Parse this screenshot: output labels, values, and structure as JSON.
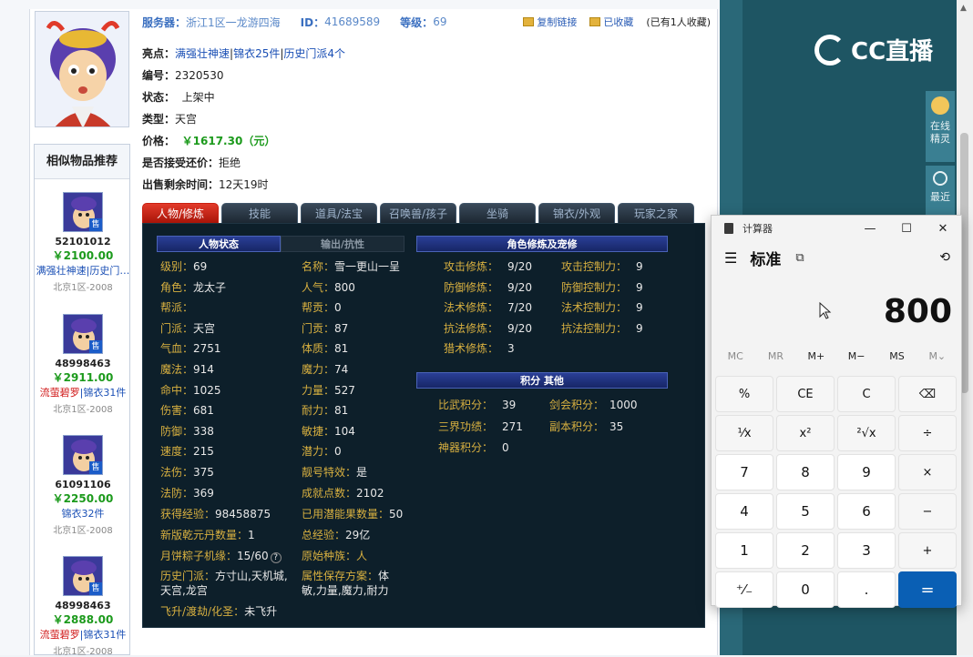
{
  "header": {
    "server_label": "服务器：",
    "server_value": "浙江1区一龙游四海",
    "id_label": "ID：",
    "id_value": "41689589",
    "level_label": "等级：",
    "level_value": "69",
    "copy_link": "复制链接",
    "favorited": "已收藏",
    "fav_count": "(已有1人收藏)"
  },
  "details": {
    "highlights_key": "亮点：",
    "highlights": [
      "满强壮神速",
      "锦衣25件",
      "历史门派4个"
    ],
    "number_key": "编号：",
    "number_value": "2320530",
    "status_key": "状态：",
    "status_value": "上架中",
    "type_key": "类型：",
    "type_value": "天宫",
    "price_key": "价格：",
    "price_value": "￥1617.30（元）",
    "counter_key": "是否接受还价：",
    "counter_value": "拒绝",
    "remain_key": "出售剩余时间：",
    "remain_value": "12天19时"
  },
  "sidebar": {
    "title": "相似物品推荐",
    "items": [
      {
        "id": "52101012",
        "price": "￥2100.00",
        "tags": "满强壮神速|历史门…",
        "server": "北京1区-2008"
      },
      {
        "id": "48998463",
        "price": "￥2911.00",
        "tag_red": "流萤碧罗",
        "tag_rest": "|锦衣31件",
        "server": "北京1区-2008"
      },
      {
        "id": "61091106",
        "price": "￥2250.00",
        "tags": "锦衣32件",
        "server": "北京1区-2008"
      },
      {
        "id": "48998463",
        "price": "￥2888.00",
        "tag_red": "流萤碧罗",
        "tag_rest": "|锦衣31件",
        "server": "北京1区-2008"
      }
    ],
    "sell_badge": "售"
  },
  "tabs": [
    "人物/修炼",
    "技能",
    "道具/法宝",
    "召唤兽/孩子",
    "坐骑",
    "锦衣/外观",
    "玩家之家"
  ],
  "panel": {
    "hdr_char": "人物状态",
    "hdr_output": "输出/抗性",
    "hdr_cultivation": "角色修炼及宠修",
    "hdr_points": "积分  其他",
    "col1": [
      {
        "k": "级别：",
        "v": "69"
      },
      {
        "k": "角色：",
        "v": "龙太子"
      },
      {
        "k": "帮派：",
        "v": ""
      },
      {
        "k": "门派：",
        "v": "天宫"
      },
      {
        "k": "气血：",
        "v": "2751"
      },
      {
        "k": "魔法：",
        "v": "914"
      },
      {
        "k": "命中：",
        "v": "1025"
      },
      {
        "k": "伤害：",
        "v": "681"
      },
      {
        "k": "防御：",
        "v": "338"
      },
      {
        "k": "速度：",
        "v": "215"
      },
      {
        "k": "法伤：",
        "v": "375"
      },
      {
        "k": "法防：",
        "v": "369"
      }
    ],
    "col2": [
      {
        "k": "名称：",
        "v": "雪一更山一呈"
      },
      {
        "k": "人气：",
        "v": "800"
      },
      {
        "k": "帮贡：",
        "v": "0"
      },
      {
        "k": "门贡：",
        "v": "87"
      },
      {
        "k": "体质：",
        "v": "81"
      },
      {
        "k": "魔力：",
        "v": "74"
      },
      {
        "k": "力量：",
        "v": "527"
      },
      {
        "k": "耐力：",
        "v": "81"
      },
      {
        "k": "敏捷：",
        "v": "104"
      },
      {
        "k": "潜力：",
        "v": "0"
      },
      {
        "k": "靓号特效：",
        "v": "是"
      },
      {
        "k": "成就点数：",
        "v": "2102"
      }
    ],
    "bottom": {
      "exp_k": "获得经验：",
      "exp_v": "98458875",
      "used_k": "已用潜能果数量：",
      "used_v": "50",
      "qk_k": "新版乾元丹数量：",
      "qk_v": "1",
      "total_k": "总经验：",
      "total_v": "29亿",
      "moon_k": "月饼粽子机缘：",
      "moon_v": "15/60",
      "race_k": "原始种族：",
      "race_v": "人",
      "hist_k": "历史门派：",
      "hist_v1": "方寸山,天机城,",
      "hist_v2": "天宫,龙宫",
      "attr_k": "属性保存方案：",
      "attr_v1": "体",
      "attr_v2": "敏,力量,魔力,耐力",
      "fly_k": "飞升/渡劫/化圣：",
      "fly_v": "未飞升"
    },
    "cult": [
      {
        "k": "攻击修炼：",
        "v": "9/20",
        "k2": "攻击控制力：",
        "v2": "9"
      },
      {
        "k": "防御修炼：",
        "v": "9/20",
        "k2": "防御控制力：",
        "v2": "9"
      },
      {
        "k": "法术修炼：",
        "v": "7/20",
        "k2": "法术控制力：",
        "v2": "9"
      },
      {
        "k": "抗法修炼：",
        "v": "9/20",
        "k2": "抗法控制力：",
        "v2": "9"
      },
      {
        "k": "猎术修炼：",
        "v": "3"
      }
    ],
    "points": {
      "pk_k": "比武积分：",
      "pk_v": "39",
      "sword_k": "剑会积分：",
      "sword_v": "1000",
      "three_k": "三界功绩：",
      "three_v": "271",
      "dungeon_k": "副本积分：",
      "dungeon_v": "35",
      "artifact_k": "神器积分：",
      "artifact_v": "0"
    }
  },
  "right": {
    "logo": "CC直播",
    "online": "在线精灵",
    "recent": "最近"
  },
  "calculator": {
    "title": "计算器",
    "mode": "标准",
    "display": "800",
    "memory": [
      "MC",
      "MR",
      "M+",
      "M−",
      "MS",
      "M⌄"
    ],
    "keys": [
      "%",
      "CE",
      "C",
      "⌫",
      "¹⁄x",
      "x²",
      "²√x",
      "÷",
      "7",
      "8",
      "9",
      "×",
      "4",
      "5",
      "6",
      "−",
      "1",
      "2",
      "3",
      "+",
      "⁺⁄₋",
      "0",
      ".",
      "="
    ]
  }
}
